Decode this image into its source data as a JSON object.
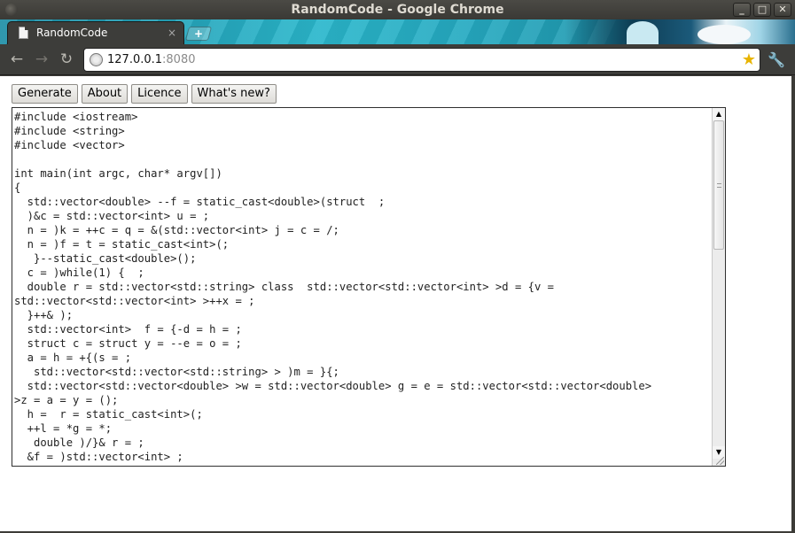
{
  "window": {
    "title": "RandomCode - Google Chrome",
    "controls": {
      "minimize": "_",
      "maximize": "□",
      "close": "✕"
    }
  },
  "tab": {
    "title": "RandomCode",
    "close": "×",
    "new_tab": "+"
  },
  "toolbar": {
    "back": "←",
    "forward": "→",
    "reload": "↻",
    "url_host": "127.0.0.1",
    "url_port": ":8080",
    "star": "★",
    "wrench": "🔧"
  },
  "buttons": {
    "generate": "Generate",
    "about": "About",
    "licence": "Licence",
    "whats_new": "What's new?"
  },
  "code": {
    "text": "#include <iostream>\n#include <string>\n#include <vector>\n\nint main(int argc, char* argv[])\n{\n  std::vector<double> --f = static_cast<double>(struct  ;\n  )&c = std::vector<int> u = ;\n  n = )k = ++c = q = &(std::vector<int> j = c = /;\n  n = )f = t = static_cast<int>(;\n   }--static_cast<double>();\n  c = )while(1) {  ;\n  double r = std::vector<std::string> class  std::vector<std::vector<int> >d = {v =\nstd::vector<std::vector<int> >++x = ;\n  }++& );\n  std::vector<int>  f = {-d = h = ;\n  struct c = struct y = --e = o = ;\n  a = h = +{(s = ;\n   std::vector<std::vector<std::string> > )m = }{;\n  std::vector<std::vector<double> >w = std::vector<double> g = e = std::vector<std::vector<double>\n>z = a = y = ();\n  h =  r = static_cast<int>(;\n  ++l = *g = *;\n   double )/}& r = ;\n  &f = )std::vector<int> ;"
  },
  "scrollbar": {
    "up": "▲",
    "down": "▼"
  },
  "colors": {
    "accent_tabstrip": "#2ab7cc",
    "chrome_dark": "#3d3d3a",
    "page_bg": "#ffffff"
  }
}
